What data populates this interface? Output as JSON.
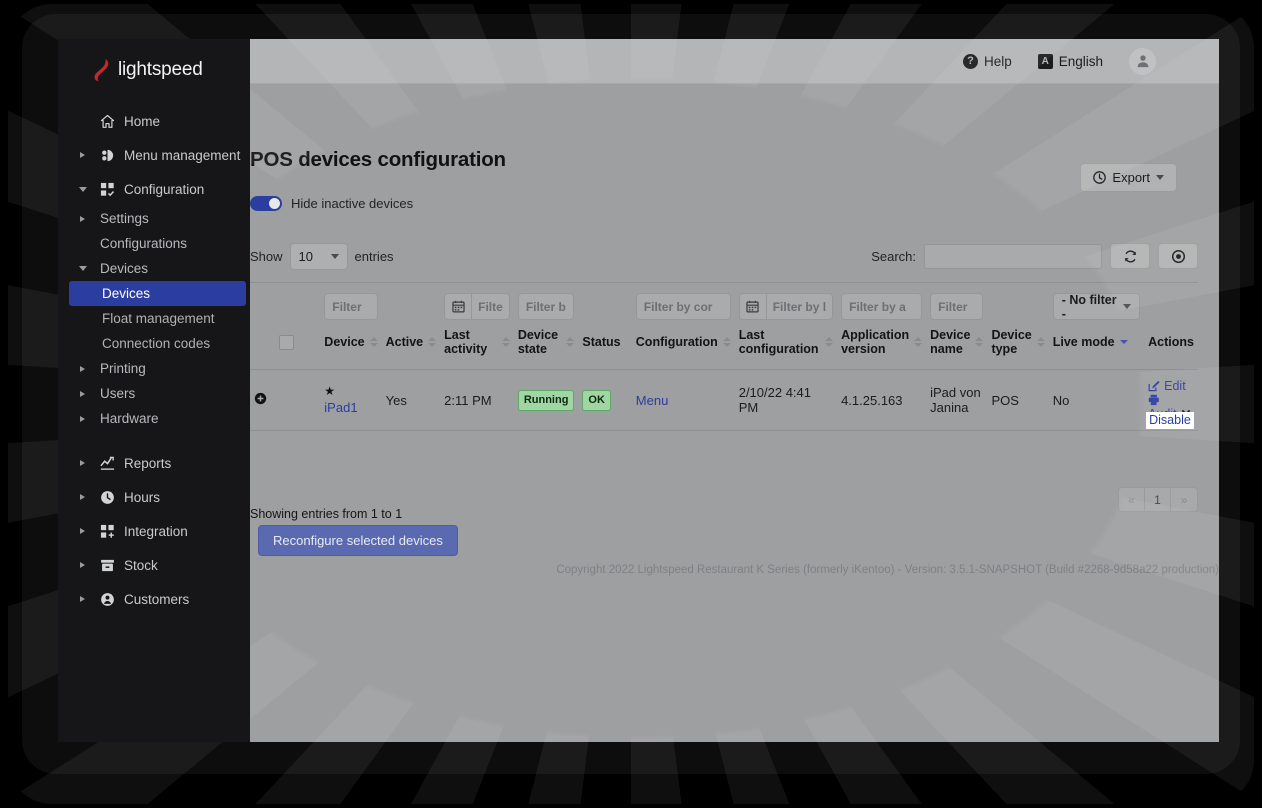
{
  "brand": {
    "name": "lightspeed"
  },
  "sidebar": {
    "items": [
      {
        "label": "Home",
        "icon": "home-icon",
        "level": 0,
        "caret": "none",
        "active": false
      },
      {
        "label": "Menu management",
        "icon": "menu-management-icon",
        "level": 0,
        "caret": "closed",
        "active": false
      },
      {
        "label": "Configuration",
        "icon": "configuration-icon",
        "level": 0,
        "caret": "open",
        "active": false
      },
      {
        "label": "Settings",
        "icon": "none",
        "level": 1,
        "caret": "closed",
        "active": false
      },
      {
        "label": "Configurations",
        "icon": "none",
        "level": 1,
        "caret": "none",
        "active": false
      },
      {
        "label": "Devices",
        "icon": "none",
        "level": 1,
        "caret": "open",
        "active": false
      },
      {
        "label": "Devices",
        "icon": "none",
        "level": 2,
        "caret": "none",
        "active": true
      },
      {
        "label": "Float management",
        "icon": "none",
        "level": 2,
        "caret": "none",
        "active": false
      },
      {
        "label": "Connection codes",
        "icon": "none",
        "level": 2,
        "caret": "none",
        "active": false
      },
      {
        "label": "Printing",
        "icon": "none",
        "level": 1,
        "caret": "closed",
        "active": false
      },
      {
        "label": "Users",
        "icon": "none",
        "level": 1,
        "caret": "closed",
        "active": false
      },
      {
        "label": "Hardware",
        "icon": "none",
        "level": 1,
        "caret": "closed",
        "active": false
      },
      {
        "label": "Reports",
        "icon": "reports-icon",
        "level": 0,
        "caret": "closed",
        "active": false
      },
      {
        "label": "Hours",
        "icon": "hours-icon",
        "level": 0,
        "caret": "closed",
        "active": false
      },
      {
        "label": "Integration",
        "icon": "integration-icon",
        "level": 0,
        "caret": "closed",
        "active": false
      },
      {
        "label": "Stock",
        "icon": "stock-icon",
        "level": 0,
        "caret": "closed",
        "active": false
      },
      {
        "label": "Customers",
        "icon": "customers-icon",
        "level": 0,
        "caret": "closed",
        "active": false
      }
    ]
  },
  "topbar": {
    "help_label": "Help",
    "help_icon_char": "?",
    "language_label": "English",
    "language_badge_char": "A"
  },
  "page": {
    "title": "POS devices configuration",
    "export_label": "Export",
    "hide_inactive_label": "Hide inactive devices",
    "hide_inactive_on": true
  },
  "table_controls": {
    "show_label": "Show",
    "entries_label": "entries",
    "page_length": "10",
    "search_label": "Search:",
    "search_value": "",
    "search_placeholder": ""
  },
  "table": {
    "filters": [
      {
        "placeholder": "",
        "type": "none"
      },
      {
        "placeholder": "",
        "type": "none"
      },
      {
        "placeholder": "Filter",
        "type": "text"
      },
      {
        "placeholder": "",
        "type": "none"
      },
      {
        "placeholder": "Filte",
        "type": "date"
      },
      {
        "placeholder": "Filter b",
        "type": "text"
      },
      {
        "placeholder": "",
        "type": "none"
      },
      {
        "placeholder": "Filter by cor",
        "type": "text"
      },
      {
        "placeholder": "Filter by l",
        "type": "date"
      },
      {
        "placeholder": "Filter by a",
        "type": "text"
      },
      {
        "placeholder": "Filter",
        "type": "text"
      },
      {
        "placeholder": "",
        "type": "none"
      },
      {
        "placeholder": "- No filter -",
        "type": "select"
      },
      {
        "placeholder": "",
        "type": "none"
      }
    ],
    "columns": [
      {
        "label": "",
        "sortable": false
      },
      {
        "label": "",
        "sortable": false
      },
      {
        "label": "Device",
        "sortable": true
      },
      {
        "label": "Active",
        "sortable": true
      },
      {
        "label": "Last activity",
        "sortable": true
      },
      {
        "label": "Device state",
        "sortable": true
      },
      {
        "label": "Status",
        "sortable": false
      },
      {
        "label": "Configuration",
        "sortable": true
      },
      {
        "label": "Last configuration",
        "sortable": true
      },
      {
        "label": "Application version",
        "sortable": true
      },
      {
        "label": "Device name",
        "sortable": true
      },
      {
        "label": "Device type",
        "sortable": true
      },
      {
        "label": "Live mode",
        "sortable": true,
        "sort_active": "desc"
      },
      {
        "label": "Actions",
        "sortable": false
      }
    ],
    "rows": [
      {
        "device": "iPad1",
        "favourite": true,
        "active": "Yes",
        "last_activity": "2:11 PM",
        "device_state": "Running",
        "status": "OK",
        "configuration": "Menu",
        "last_configuration": "2/10/22 4:41 PM",
        "application_version": "4.1.25.163",
        "device_name": "iPad von Janina",
        "device_type": "POS",
        "live_mode": "No",
        "actions": {
          "edit": "Edit",
          "audit": "Audit",
          "tooltip": "Disable"
        }
      }
    ]
  },
  "footer": {
    "entries_info": "Showing entries from 1 to 1",
    "reconfigure_label": "Reconfigure selected devices",
    "pager": {
      "prev": "«",
      "current": "1",
      "next": "»"
    },
    "copyright": "Copyright 2022 Lightspeed Restaurant K Series (formerly iKentoo) - Version: 3.5.1-SNAPSHOT (Build #2268-9d58a22 production)"
  }
}
